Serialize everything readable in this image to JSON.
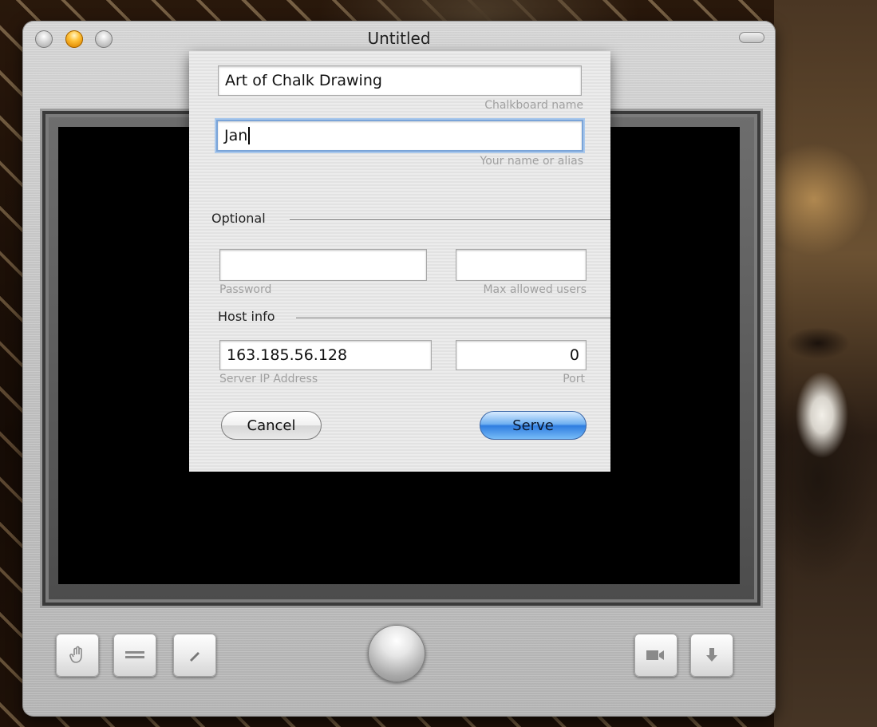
{
  "window": {
    "title": "Untitled"
  },
  "dialog": {
    "chalkboard_name": {
      "value": "Art of Chalk Drawing",
      "hint": "Chalkboard name"
    },
    "user_name": {
      "value": "Jan",
      "hint": "Your name or alias"
    },
    "optional": {
      "label": "Optional",
      "password": {
        "value": "",
        "hint": "Password"
      },
      "max_users": {
        "value": "",
        "hint": "Max allowed users"
      }
    },
    "host_info": {
      "label": "Host info",
      "server_ip": {
        "value": "163.185.56.128",
        "hint": "Server IP Address"
      },
      "port": {
        "value": "0",
        "hint": "Port"
      }
    },
    "cancel_label": "Cancel",
    "serve_label": "Serve"
  },
  "toolbar": {
    "left_tools": [
      "hand-icon",
      "lines-icon",
      "pencil-icon"
    ],
    "center": "main-orb-button",
    "right_tools": [
      "video-camera-icon",
      "download-arrow-icon"
    ]
  },
  "colors": {
    "accent_blue": "#2f7de0",
    "focus_ring": "#7aa4d8",
    "board": "#000000"
  }
}
